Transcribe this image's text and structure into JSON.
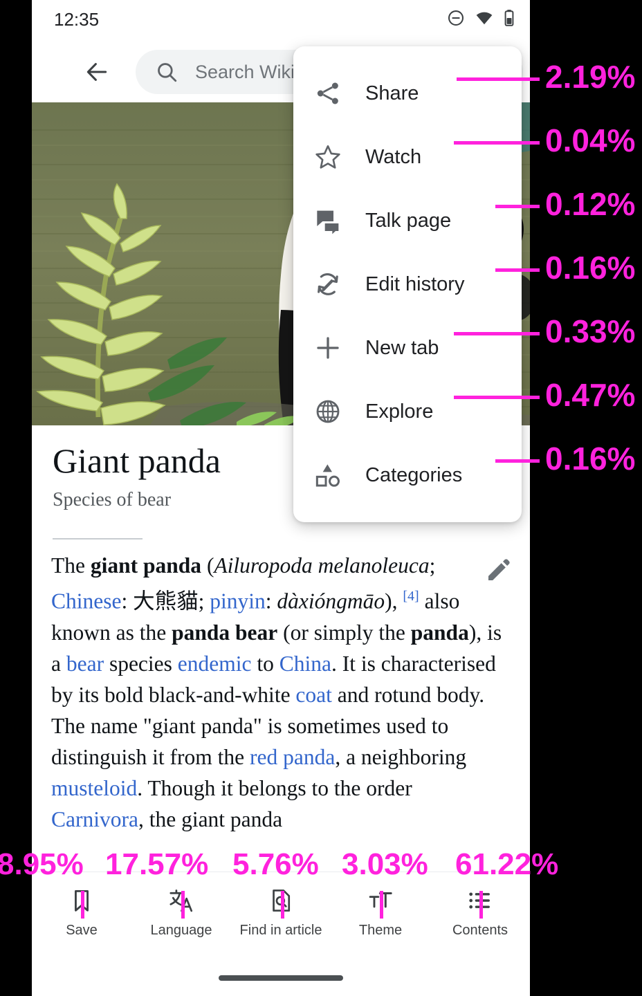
{
  "status_bar": {
    "time": "12:35",
    "icons": [
      "do-not-disturb-icon",
      "wifi-icon",
      "battery-icon"
    ]
  },
  "toolbar": {
    "back_icon": "back-arrow-icon",
    "search_icon": "search-icon",
    "search_placeholder": "Search Wikipedia"
  },
  "hero": {
    "alt": "Giant panda standing on grass beside variegated plants"
  },
  "article": {
    "title": "Giant panda",
    "subtitle": "Species of bear",
    "edit_icon": "edit-pencil-icon",
    "paragraph_runs": [
      {
        "t": "The ",
        "s": "plain"
      },
      {
        "t": "giant panda",
        "s": "bold"
      },
      {
        "t": " (",
        "s": "plain"
      },
      {
        "t": "Ailuropoda melanoleuca",
        "s": "italic"
      },
      {
        "t": "; ",
        "s": "plain"
      },
      {
        "t": "Chinese",
        "s": "link"
      },
      {
        "t": ": 大熊貓; ",
        "s": "plain"
      },
      {
        "t": "pinyin",
        "s": "link"
      },
      {
        "t": ": ",
        "s": "plain"
      },
      {
        "t": "dàxióngmāo",
        "s": "italic"
      },
      {
        "t": "), ",
        "s": "plain"
      },
      {
        "t": "[4]",
        "s": "sup"
      },
      {
        "t": " also known as the ",
        "s": "plain"
      },
      {
        "t": "panda bear",
        "s": "bold"
      },
      {
        "t": " (or simply the ",
        "s": "plain"
      },
      {
        "t": "panda",
        "s": "bold"
      },
      {
        "t": "), is a ",
        "s": "plain"
      },
      {
        "t": "bear",
        "s": "link"
      },
      {
        "t": " species ",
        "s": "plain"
      },
      {
        "t": "endemic",
        "s": "link"
      },
      {
        "t": " to ",
        "s": "plain"
      },
      {
        "t": "China",
        "s": "link"
      },
      {
        "t": ". It is characterised by its bold black-and-white ",
        "s": "plain"
      },
      {
        "t": "coat",
        "s": "link"
      },
      {
        "t": " and rotund body. The name \"giant panda\" is sometimes used to distinguish it from the ",
        "s": "plain"
      },
      {
        "t": "red panda",
        "s": "link"
      },
      {
        "t": ", a neighboring ",
        "s": "plain"
      },
      {
        "t": "musteloid",
        "s": "link"
      },
      {
        "t": ". Though it belongs to the order ",
        "s": "plain"
      },
      {
        "t": "Carnivora",
        "s": "link"
      },
      {
        "t": ", the giant panda",
        "s": "plain"
      }
    ]
  },
  "popup_menu": {
    "items": [
      {
        "label": "Share",
        "icon": "share-icon"
      },
      {
        "label": "Watch",
        "icon": "star-outline-icon"
      },
      {
        "label": "Talk page",
        "icon": "talk-bubbles-icon"
      },
      {
        "label": "Edit history",
        "icon": "edit-history-icon"
      },
      {
        "label": "New tab",
        "icon": "plus-icon"
      },
      {
        "label": "Explore",
        "icon": "globe-icon"
      },
      {
        "label": "Categories",
        "icon": "categories-shapes-icon"
      }
    ]
  },
  "bottom_bar": {
    "items": [
      {
        "label": "Save",
        "icon": "bookmark-icon"
      },
      {
        "label": "Language",
        "icon": "language-translate-icon"
      },
      {
        "label": "Find in article",
        "icon": "find-in-page-icon"
      },
      {
        "label": "Theme",
        "icon": "text-size-icon"
      },
      {
        "label": "Contents",
        "icon": "contents-list-icon"
      }
    ],
    "gesture_bar": "home-gesture-indicator"
  },
  "annotations": {
    "accent_color": "#ff22dd",
    "right_labels": [
      {
        "text": "2.19%",
        "target": "Share"
      },
      {
        "text": "0.04%",
        "target": "Watch"
      },
      {
        "text": "0.12%",
        "target": "Talk page"
      },
      {
        "text": "0.16%",
        "target": "Edit history"
      },
      {
        "text": "0.33%",
        "target": "New tab"
      },
      {
        "text": "0.47%",
        "target": "Explore"
      },
      {
        "text": "0.16%",
        "target": "Categories"
      }
    ],
    "bottom_labels": [
      {
        "text": "8.95%",
        "target": "Save"
      },
      {
        "text": "17.57%",
        "target": "Language"
      },
      {
        "text": "5.76%",
        "target": "Find in article"
      },
      {
        "text": "3.03%",
        "target": "Theme"
      },
      {
        "text": "61.22%",
        "target": "Contents"
      }
    ]
  }
}
